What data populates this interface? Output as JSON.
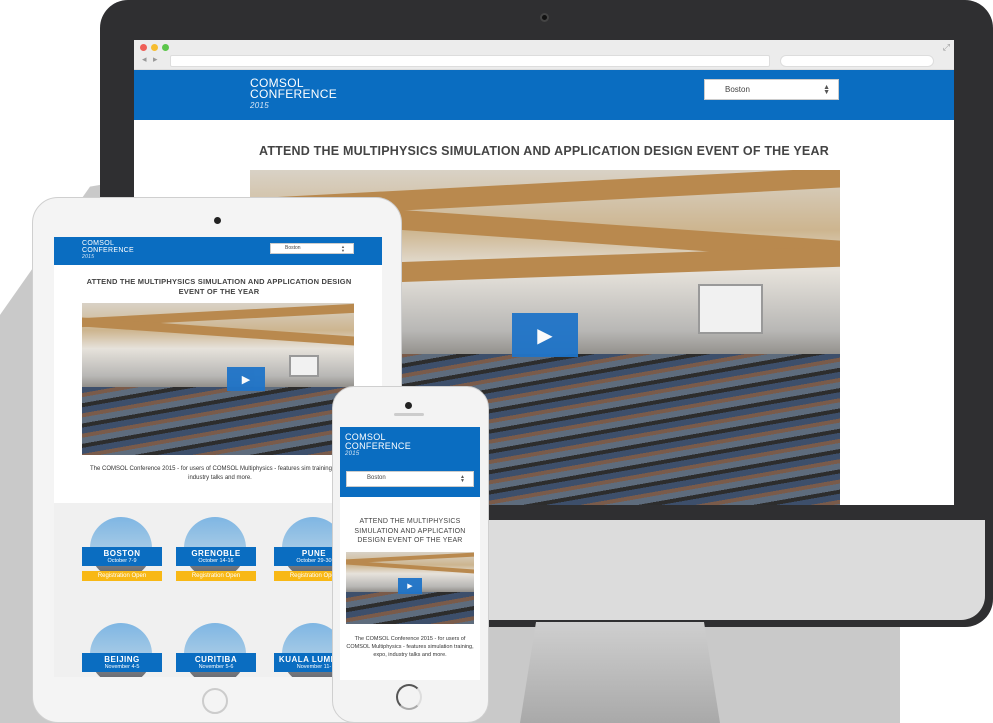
{
  "site": {
    "logo_line1": "COMSOL",
    "logo_line2": "CONFERENCE",
    "logo_year": "2015",
    "city_select_value": "Boston",
    "headline": "ATTEND THE MULTIPHYSICS SIMULATION AND APPLICATION DESIGN EVENT OF THE YEAR",
    "tablet_headline": "ATTEND THE MULTIPHYSICS SIMULATION AND APPLICATION DESIGN EVENT OF THE YEAR",
    "phone_headline": "ATTEND THE MULTIPHYSICS SIMULATION AND APPLICATION DESIGN EVENT OF THE YEAR",
    "tablet_body": "The COMSOL Conference 2015 - for users of COMSOL Multiphysics - features sim training, expo, industry talks and more.",
    "phone_body": "The COMSOL Conference 2015 - for users of COMSOL Multiphysics - features simulation training, expo, industry talks and more."
  },
  "conferences": [
    {
      "city": "BOSTON",
      "dates": "October 7-9",
      "status": "Registration Open"
    },
    {
      "city": "GRENOBLE",
      "dates": "October 14-16",
      "status": "Registration Open"
    },
    {
      "city": "PUNE",
      "dates": "October 29-30",
      "status": "Registration Open"
    },
    {
      "city": "BEIJING",
      "dates": "November 4-5"
    },
    {
      "city": "CURITIBA",
      "dates": "November 5-6"
    },
    {
      "city": "KUALA LUMPUR",
      "dates": "November 11-"
    }
  ],
  "icons": {
    "play": "play-icon",
    "select_arrows": "updown-chevron-icon",
    "browser_back": "back-arrow-icon",
    "browser_forward": "forward-arrow-icon",
    "browser_new_tab": "plus-icon",
    "fullscreen": "expand-icon"
  },
  "colors": {
    "brand_blue": "#0a6dc1",
    "registration_yellow": "#f8b815",
    "play_blue": "#1f74c8"
  }
}
